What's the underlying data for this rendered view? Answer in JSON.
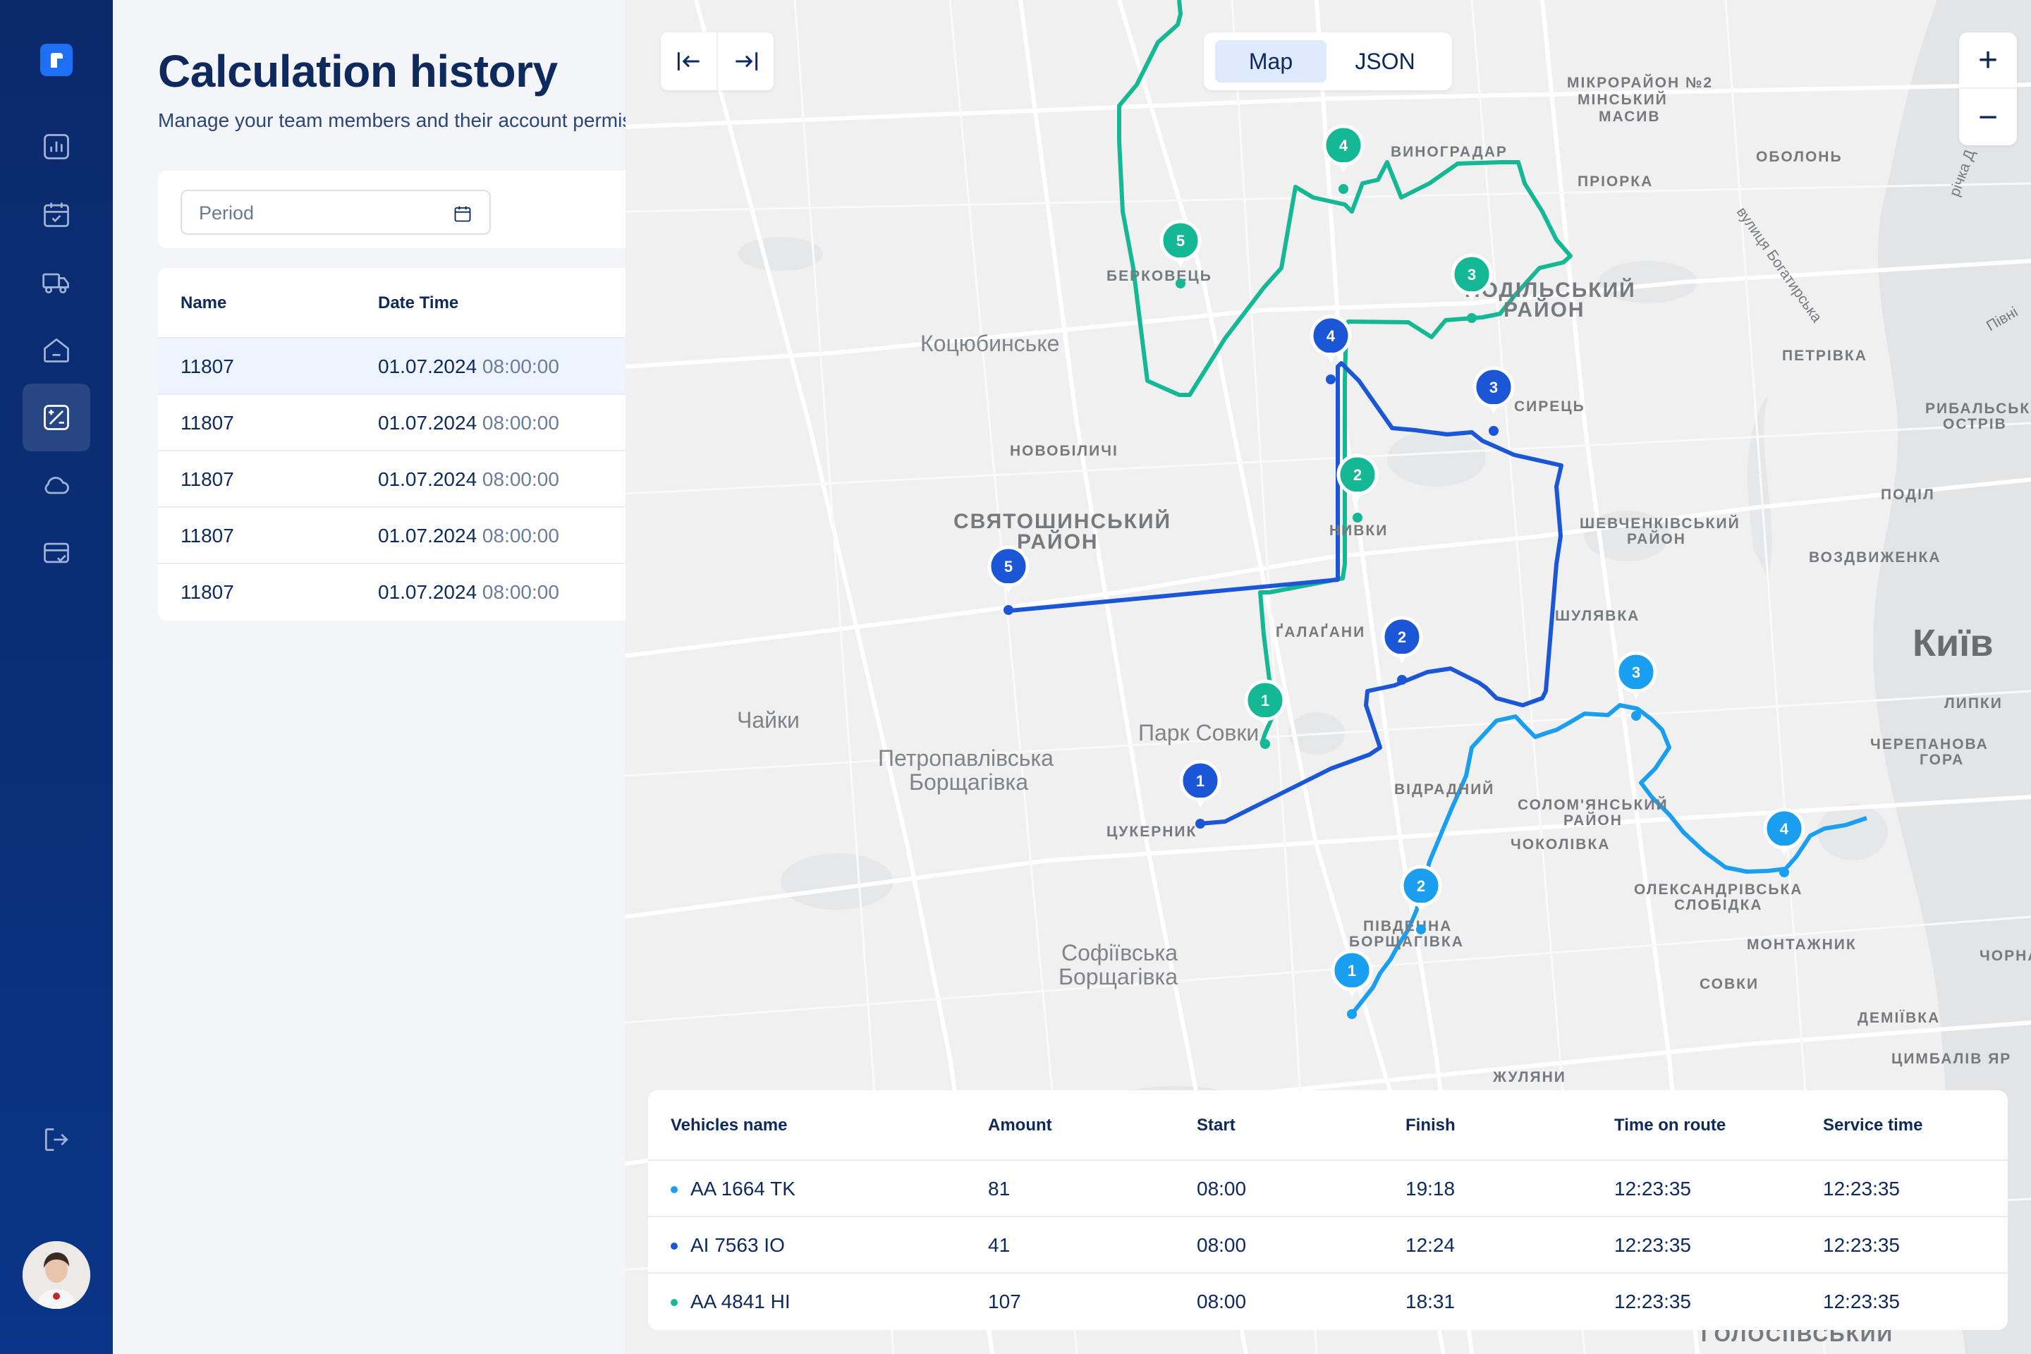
{
  "sidebar": {
    "items": [
      {
        "name": "chart",
        "active": false
      },
      {
        "name": "calendar-check",
        "active": false
      },
      {
        "name": "truck",
        "active": false
      },
      {
        "name": "home",
        "active": false
      },
      {
        "name": "calculator",
        "active": true
      },
      {
        "name": "cloud",
        "active": false
      },
      {
        "name": "credit-card",
        "active": false
      }
    ],
    "logout_icon": "logout-icon"
  },
  "page": {
    "title": "Calculation history",
    "subtitle": "Manage your team members and their account permissions here."
  },
  "filter": {
    "period_placeholder": "Period"
  },
  "history": {
    "columns": [
      "Name",
      "Date Time"
    ],
    "rows": [
      {
        "name": "11807",
        "date": "01.07.2024",
        "time": "08:00:00"
      },
      {
        "name": "11807",
        "date": "01.07.2024",
        "time": "08:00:00"
      },
      {
        "name": "11807",
        "date": "01.07.2024",
        "time": "08:00:00"
      },
      {
        "name": "11807",
        "date": "01.07.2024",
        "time": "08:00:00"
      },
      {
        "name": "11807",
        "date": "01.07.2024",
        "time": "08:00:00"
      }
    ]
  },
  "map": {
    "view_toggle": {
      "map": "Map",
      "json": "JSON",
      "selected": "Map"
    },
    "zoom_in": "+",
    "zoom_out": "−",
    "labels": {
      "kyiv": "Київ",
      "kotsiubynske": "Коцюбинське",
      "chaiky": "Чайки",
      "petropavlivska": "Петропавлівська",
      "borshchahivka1": "Борщагівка",
      "park_sovky": "Парк Совки",
      "sofiivska": "Софіївська",
      "borshchahivka2": "Борщагівка",
      "mikroraion": "МІКРОРАЙОН №2",
      "minskyi": "МІНСЬКИЙ",
      "masyv": "МАСИВ",
      "obolon": "ОБОЛОНЬ",
      "vynohradar": "ВИНОГРАДАР",
      "priorka": "ПРІОРКА",
      "berkovets": "БЕРКОВЕЦЬ",
      "podilskyi": "ПОДІЛЬСЬКИЙ",
      "raion": "РАЙОН",
      "syrets": "СИРЕЦЬ",
      "petrivka": "ПЕТРІВКА",
      "rybalskyi": "РИБАЛЬСЬКИЙ",
      "ostriv": "ОСТРІВ",
      "podil": "ПОДІЛ",
      "novobilychi": "НОВОБІЛИЧІ",
      "sviatoshynskyi": "СВЯТОШИНСЬКИЙ",
      "raion2": "РАЙОН",
      "nyvky": "НИВКИ",
      "shevchenkivskyi": "ШЕВЧЕНКІВСЬКИЙ",
      "raion3": "РАЙОН",
      "vozdvyzhenka": "ВОЗДВИЖЕНКА",
      "shuliavka": "ШУЛЯВКА",
      "halahany": "ҐАЛАҐАНИ",
      "lypky": "ЛИПКИ",
      "cherepanova": "ЧЕРЕПАНОВА",
      "hora": "ГОРА",
      "vidradnyi": "ВІДРАДНИЙ",
      "solomianskyi": "СОЛОМ'ЯНСЬКИЙ",
      "raion4": "РАЙОН",
      "chokolivka": "ЧОКОЛІВКА",
      "tsukernyk": "ЦУКЕРНИК",
      "oleksandrivska": "ОЛЕКСАНДРІВСЬКА",
      "slobidka": "СЛОБІДКА",
      "pivdenna": "ПІВДЕННА",
      "borshchahivka3": "БОРЩАГІВКА",
      "montazhnyk": "МОНТАЖНИК",
      "sovky": "СОВКИ",
      "demiivka": "ДЕМІЇВКА",
      "tsymbaliv": "ЦИМБАЛІВ ЯР",
      "zhuliany": "ЖУЛЯНИ",
      "holosiivskyi": "ГОЛОСІЇВСЬКИЙ",
      "chorna": "ЧОРНА",
      "bohatyrska": "вулиця Богатирська",
      "richka": "річка Д",
      "pivnich": "Півні"
    },
    "markers": {
      "teal": [
        "4",
        "5",
        "3",
        "2",
        "1"
      ],
      "navy": [
        "4",
        "3",
        "5",
        "2",
        "1"
      ],
      "sky": [
        "3",
        "4",
        "2",
        "1"
      ]
    }
  },
  "vehicles": {
    "columns": [
      "Vehicles name",
      "Amount",
      "Start",
      "Finish",
      "Time on route",
      "Service time"
    ],
    "rows": [
      {
        "name": "AA 1664 TK",
        "amount": "81",
        "start": "08:00",
        "finish": "19:18",
        "time_on_route": "12:23:35",
        "service_time": "12:23:35",
        "color": "#1a9ff0"
      },
      {
        "name": "AI 7563 IO",
        "amount": "41",
        "start": "08:00",
        "finish": "12:24",
        "time_on_route": "12:23:35",
        "service_time": "12:23:35",
        "color": "#1a56d6"
      },
      {
        "name": "AA 4841 HI",
        "amount": "107",
        "start": "08:00",
        "finish": "18:31",
        "time_on_route": "12:23:35",
        "service_time": "12:23:35",
        "color": "#15b894"
      }
    ]
  },
  "colors": {
    "sidebar_bg": "#0b2a6c",
    "route_teal": "#15b894",
    "route_navy": "#1a56d6",
    "route_sky": "#1a9ff0",
    "title": "#0e2a5c"
  }
}
